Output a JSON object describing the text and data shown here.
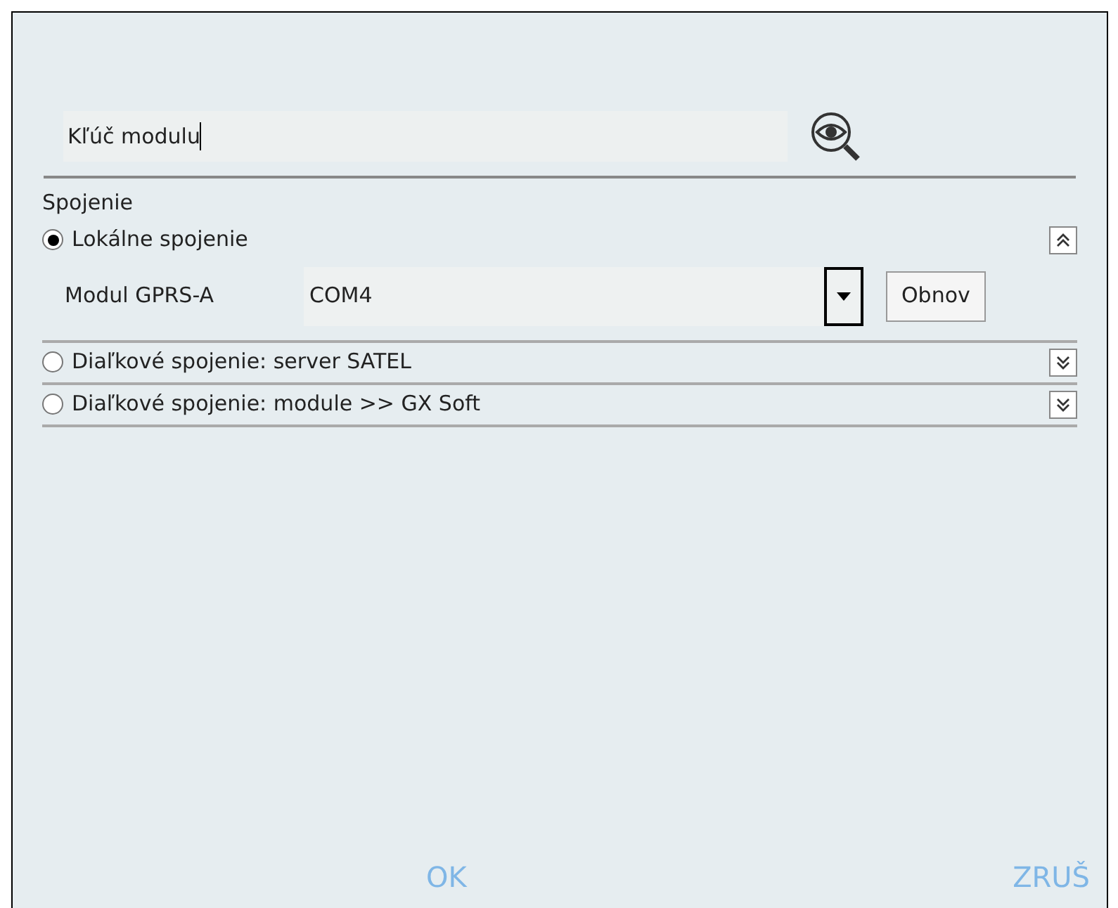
{
  "key_field": {
    "label": "Kľúč modulu"
  },
  "connection": {
    "title": "Spojenie",
    "options": [
      {
        "label": "Lokálne spojenie",
        "selected": true,
        "expanded": true,
        "module": {
          "label": "Modul GPRS-A",
          "value": "COM4",
          "refresh": "Obnov"
        }
      },
      {
        "label": "Diaľkové spojenie: server SATEL",
        "selected": false,
        "expanded": false
      },
      {
        "label": "Diaľkové spojenie: module >> GX Soft",
        "selected": false,
        "expanded": false
      }
    ]
  },
  "buttons": [
    {
      "label": "OK"
    },
    {
      "label": "ZRUŠ"
    }
  ]
}
